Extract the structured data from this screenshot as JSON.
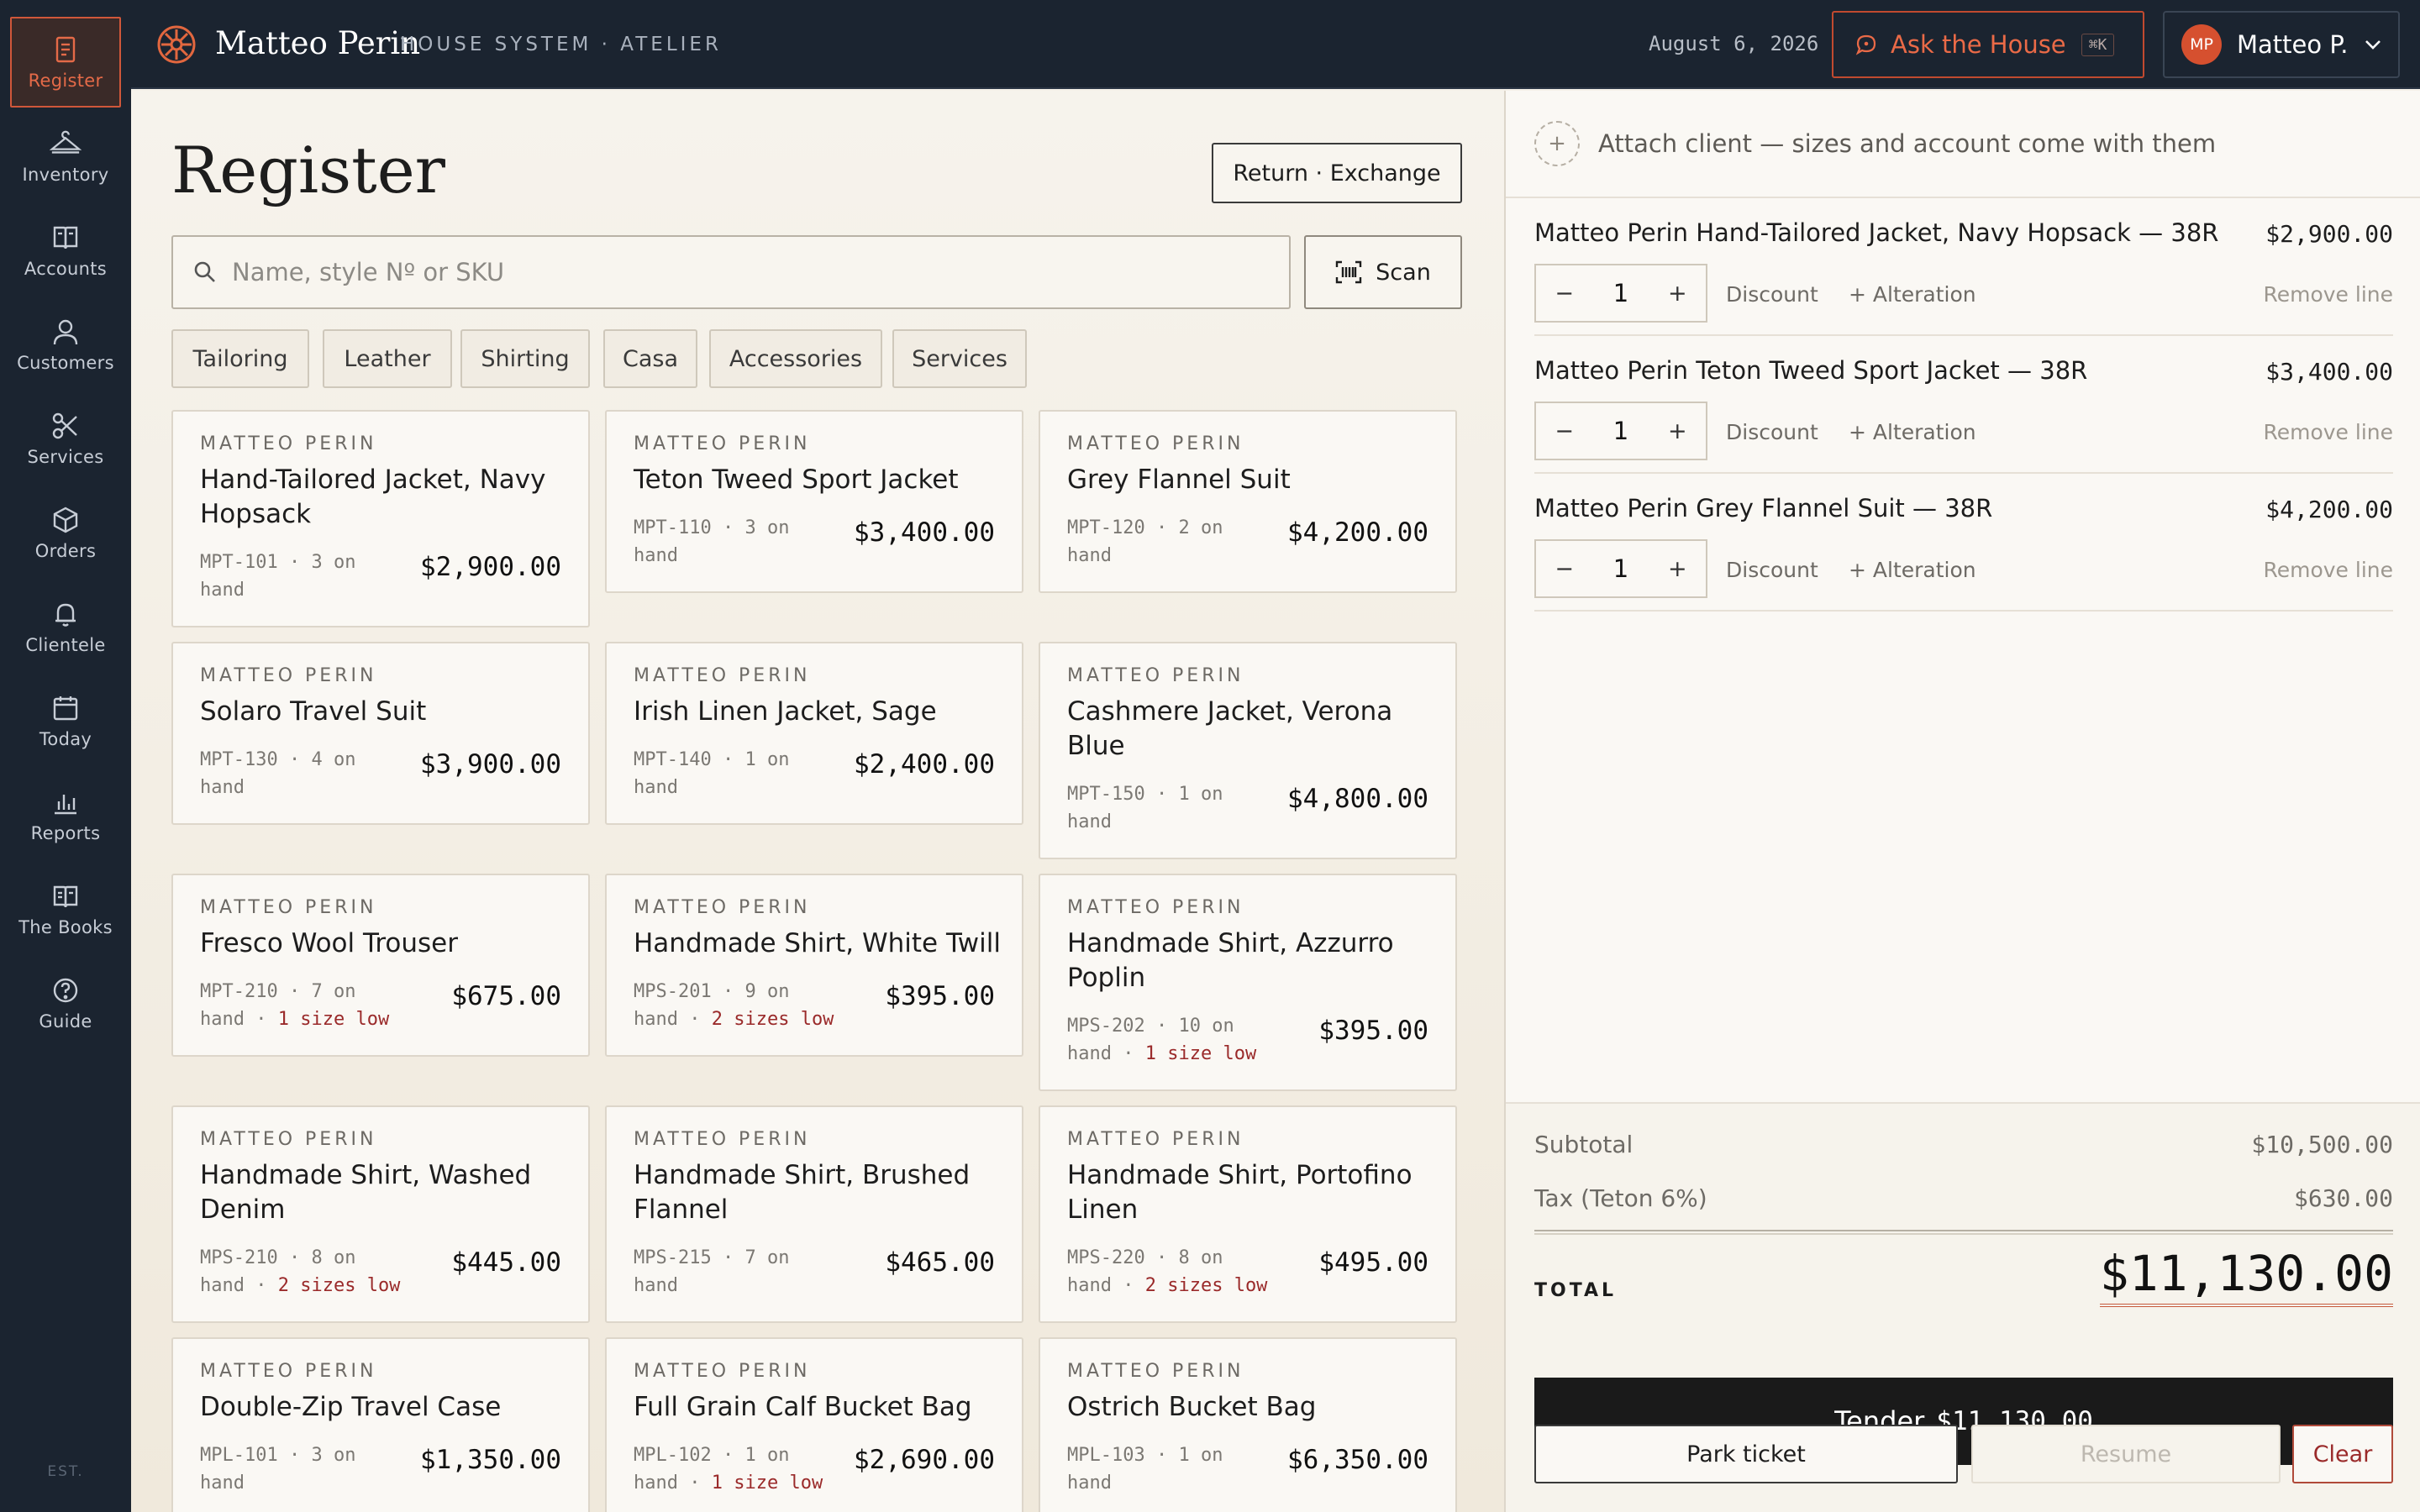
{
  "nav": [
    {
      "label": "Register",
      "icon": "register-icon",
      "active": true
    },
    {
      "label": "Inventory",
      "icon": "hanger-icon"
    },
    {
      "label": "Accounts",
      "icon": "book-icon"
    },
    {
      "label": "Customers",
      "icon": "person-icon"
    },
    {
      "label": "Services",
      "icon": "scissors-icon"
    },
    {
      "label": "Orders",
      "icon": "box-icon"
    },
    {
      "label": "Clientele",
      "icon": "bell-icon"
    },
    {
      "label": "Today",
      "icon": "calendar-icon"
    },
    {
      "label": "Reports",
      "icon": "bar-chart-icon"
    },
    {
      "label": "The Books",
      "icon": "open-book-icon"
    },
    {
      "label": "Guide",
      "icon": "help-icon"
    }
  ],
  "nav_footer": "EST.",
  "header": {
    "brand": "Matteo Perin",
    "subtitle": "HOUSE SYSTEM · ATELIER",
    "date": "August 6, 2026",
    "ask_label": "Ask the House",
    "ask_shortcut": "⌘K",
    "user_initials": "MP",
    "user_name": "Matteo P."
  },
  "main": {
    "title": "Register",
    "return_label": "Return · Exchange",
    "search_placeholder": "Name, style Nº or SKU",
    "scan_label": "Scan",
    "categories": [
      "Tailoring",
      "Leather",
      "Shirting",
      "Casa",
      "Accessories",
      "Services"
    ],
    "products": [
      {
        "brand": "MATTEO PERIN",
        "name": "Hand-Tailored Jacket, Navy Hopsack",
        "sku": "MPT-101",
        "stock": "3 on hand",
        "low": "",
        "price": "$2,900.00"
      },
      {
        "brand": "MATTEO PERIN",
        "name": "Teton Tweed Sport Jacket",
        "sku": "MPT-110",
        "stock": "3 on hand",
        "low": "",
        "price": "$3,400.00"
      },
      {
        "brand": "MATTEO PERIN",
        "name": "Grey Flannel Suit",
        "sku": "MPT-120",
        "stock": "2 on hand",
        "low": "",
        "price": "$4,200.00"
      },
      {
        "brand": "MATTEO PERIN",
        "name": "Solaro Travel Suit",
        "sku": "MPT-130",
        "stock": "4 on hand",
        "low": "",
        "price": "$3,900.00"
      },
      {
        "brand": "MATTEO PERIN",
        "name": "Irish Linen Jacket, Sage",
        "sku": "MPT-140",
        "stock": "1 on hand",
        "low": "",
        "price": "$2,400.00"
      },
      {
        "brand": "MATTEO PERIN",
        "name": "Cashmere Jacket, Verona Blue",
        "sku": "MPT-150",
        "stock": "1 on hand",
        "low": "",
        "price": "$4,800.00"
      },
      {
        "brand": "MATTEO PERIN",
        "name": "Fresco Wool Trouser",
        "sku": "MPT-210",
        "stock": "7 on hand",
        "low": "1 size low",
        "price": "$675.00"
      },
      {
        "brand": "MATTEO PERIN",
        "name": "Handmade Shirt, White Twill",
        "sku": "MPS-201",
        "stock": "9 on hand",
        "low": "2 sizes low",
        "price": "$395.00"
      },
      {
        "brand": "MATTEO PERIN",
        "name": "Handmade Shirt, Azzurro Poplin",
        "sku": "MPS-202",
        "stock": "10 on hand",
        "low": "1 size low",
        "price": "$395.00"
      },
      {
        "brand": "MATTEO PERIN",
        "name": "Handmade Shirt, Washed Denim",
        "sku": "MPS-210",
        "stock": "8 on hand",
        "low": "2 sizes low",
        "price": "$445.00"
      },
      {
        "brand": "MATTEO PERIN",
        "name": "Handmade Shirt, Brushed Flannel",
        "sku": "MPS-215",
        "stock": "7 on hand",
        "low": "",
        "price": "$465.00"
      },
      {
        "brand": "MATTEO PERIN",
        "name": "Handmade Shirt, Portofino Linen",
        "sku": "MPS-220",
        "stock": "8 on hand",
        "low": "2 sizes low",
        "price": "$495.00"
      },
      {
        "brand": "MATTEO PERIN",
        "name": "Double-Zip Travel Case",
        "sku": "MPL-101",
        "stock": "3 on hand",
        "low": "",
        "price": "$1,350.00"
      },
      {
        "brand": "MATTEO PERIN",
        "name": "Full Grain Calf Bucket Bag",
        "sku": "MPL-102",
        "stock": "1 on hand",
        "low": "1 size low",
        "price": "$2,690.00"
      },
      {
        "brand": "MATTEO PERIN",
        "name": "Ostrich Bucket Bag",
        "sku": "MPL-103",
        "stock": "1 on hand",
        "low": "",
        "price": "$6,350.00"
      }
    ]
  },
  "ticket": {
    "attach_label": "Attach client — sizes and account come with them",
    "lines": [
      {
        "name": "Matteo Perin Hand-Tailored Jacket, Navy Hopsack — 38R",
        "price": "$2,900.00",
        "qty": "1"
      },
      {
        "name": "Matteo Perin Teton Tweed Sport Jacket — 38R",
        "price": "$3,400.00",
        "qty": "1"
      },
      {
        "name": "Matteo Perin Grey Flannel Suit — 38R",
        "price": "$4,200.00",
        "qty": "1"
      }
    ],
    "discount_label": "Discount",
    "alteration_label": "+ Alteration",
    "remove_label": "Remove line",
    "minus": "−",
    "plus": "+",
    "subtotal_label": "Subtotal",
    "subtotal": "$10,500.00",
    "tax_label": "Tax (Teton 6%)",
    "tax": "$630.00",
    "total_label": "TOTAL",
    "total": "$11,130.00",
    "tender_label": "Tender",
    "tender_amount": "$11,130.00",
    "park_label": "Park ticket",
    "resume_label": "Resume",
    "clear_label": "Clear"
  },
  "colors": {
    "accent": "#d6502f",
    "sidebar": "#1b2430",
    "low_stock": "#9a2a2a"
  }
}
